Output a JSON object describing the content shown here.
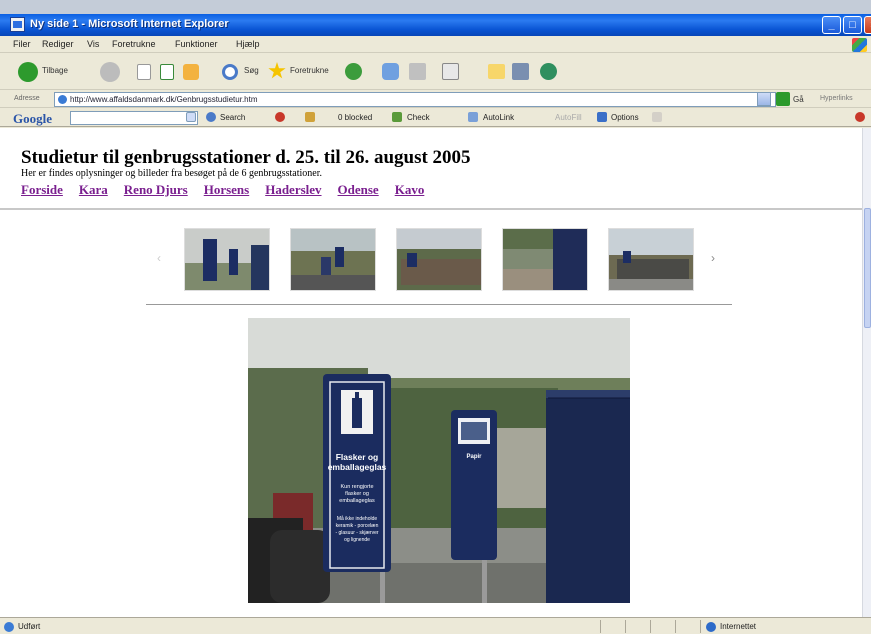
{
  "window": {
    "title": "Ny side 1 - Microsoft Internet Explorer"
  },
  "menu": [
    "Filer",
    "Rediger",
    "Vis",
    "Foretrukne",
    "Funktioner",
    "Hjælp"
  ],
  "toolbar": {
    "back_label": "Tilbage",
    "search_label": "Søg",
    "favorites_label": "Foretrukne"
  },
  "address": {
    "label": "Adresse",
    "url": "http://www.affaldsdanmark.dk/Genbrugsstudietur.htm",
    "go_label": "Gå",
    "links_label": "Hyperlinks"
  },
  "google": {
    "logo": "Google",
    "search_label": "Search",
    "blocked_label": "0 blocked",
    "check_label": "Check",
    "autolink_label": "AutoLink",
    "autofill_label": "AutoFill",
    "options_label": "Options"
  },
  "page": {
    "title": "Studietur til genbrugsstationer d. 25. til 26. august 2005",
    "subtitle": "Her er findes oplysninger og billeder fra besøget på de 6 genbrugsstationer.",
    "nav": [
      "Forside",
      "Kara",
      "Reno Djurs",
      "Horsens",
      "Haderslev",
      "Odense",
      "Kavo"
    ]
  },
  "main_photo": {
    "sign1_title": "Flasker og emballageglas",
    "sign1_body": "Kun rengjorte flasker og emballageglas",
    "sign1_footer": "Må ikke indeholde keramik - porcelæn - glasuur - skjærver og lignende",
    "sign2_title": "Papir"
  },
  "status": {
    "text": "Udført",
    "zone": "Internettet"
  },
  "colors": {
    "title_bar": "#0a55d4",
    "link_visited": "#7a1f8f",
    "sign_blue": "#1b2c5f"
  }
}
